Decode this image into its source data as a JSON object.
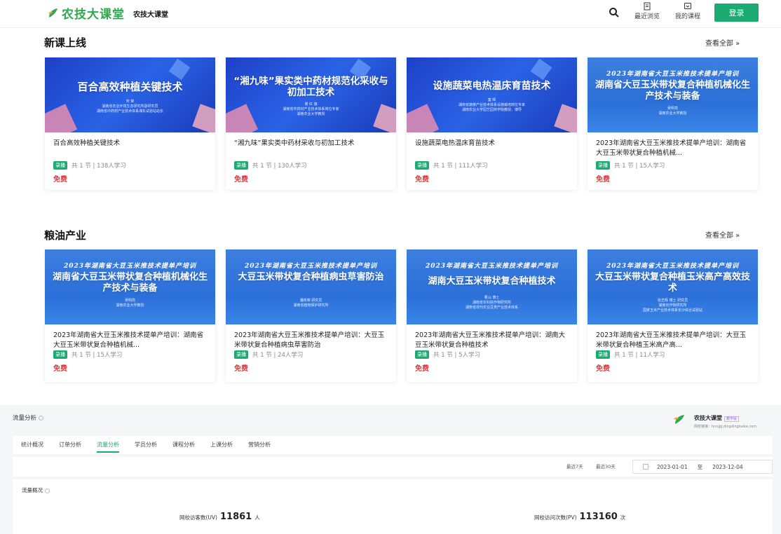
{
  "header": {
    "logo_text": "农技大课堂",
    "site_name": "农技大课堂",
    "nav": [
      {
        "label": "最近浏览",
        "icon": "history-icon"
      },
      {
        "label": "我的课程",
        "icon": "course-icon"
      }
    ],
    "login_label": "登录",
    "colors": {
      "brand": "#2fa84f",
      "accent": "#1aaa72",
      "price": "#e4393c"
    }
  },
  "sections": [
    {
      "title": "新课上线",
      "view_all": "查看全部 »",
      "courses": [
        {
          "cover_title": "百合高效种植关键技术",
          "cover_sub": [
            "宋 荣",
            "湖南省农业环境生态研究所副研究员",
            "湖南省中药材产业技术体系湘东试验站站长"
          ],
          "title": "百合高效种植关键技术",
          "tag": "录播",
          "meta": "共 1 节 | 138人学习",
          "price": "免费"
        },
        {
          "cover_title": "“湘九味”果实类中药材规范化采收与初加工技术",
          "cover_sub": [
            "谢 红 旗",
            "湖南省中药材产业技术体系岗位专家",
            "湖南农业大学教授"
          ],
          "title": "“湘九味”果实类中药材采收与初加工技术",
          "tag": "录播",
          "meta": "共 1 节 | 130人学习",
          "price": "免费"
        },
        {
          "cover_title": "设施蔬菜电热温床育苗技术",
          "cover_sub": [
            "童 辉",
            "湖南省蔬菜产业技术体系设施栽培岗位专家",
            "湖南农业大学园艺园林学院教授、博导"
          ],
          "title": "设施蔬菜电热温床育苗技术",
          "tag": "录播",
          "meta": "共 1 节 | 111人学习",
          "price": "免费"
        },
        {
          "cover_top": "2023年湖南省大豆玉米推技术提单产培训",
          "cover_title": "湖南省大豆玉米带状复合种植机械化生产技术与装备",
          "cover_sub": [
            "吴明亮",
            "湖南农业大学教授"
          ],
          "title": "2023年湖南省大豆玉米推技术提单产培训：湖南省大豆玉米带状复合种植机械...",
          "tag": "录播",
          "meta": "共 1 节 | 15人学习",
          "price": "免费"
        }
      ]
    },
    {
      "title": "粮油产业",
      "view_all": "查看全部 »",
      "courses": [
        {
          "cover_top": "2023年湖南省大豆玉米推技术提单产培训",
          "cover_title": "湖南省大豆玉米带状复合种植机械化生产技术与装备",
          "cover_sub": [
            "吴明亮",
            "湖南农业大学教授"
          ],
          "title": "2023年湖南省大豆玉米推技术提单产培训：湖南省大豆玉米带状复合种植机械...",
          "tag": "录播",
          "meta": "共 1 节 | 15人学习",
          "price": "免费"
        },
        {
          "cover_top": "2023年湖南省大豆玉米推技术提单产培训",
          "cover_title": "大豆玉米带状复合种植病虫草害防治",
          "cover_sub": [
            "潘彬荣 研究员",
            "湖南省植物保护研究所"
          ],
          "title": "2023年湖南省大豆玉米推技术提单产培训：大豆玉米带状复合种植病虫草害防治",
          "tag": "录播",
          "meta": "共 1 节 | 24人学习",
          "price": "免费"
        },
        {
          "cover_top": "2023年湖南省大豆玉米推技术提单产培训",
          "cover_title": "湖南大豆玉米带状复合种植技术",
          "cover_sub": [
            "曹山 博士",
            "湖南省农科院作物研究所",
            "湖南省现代农业豆类产业技术体系"
          ],
          "title": "2023年湖南省大豆玉米推技术提单产培训：湖南大豆玉米带状复合种植技术",
          "tag": "录播",
          "meta": "共 1 节 | 5人学习",
          "price": "免费"
        },
        {
          "cover_top": "2023年湖南省大豆玉米推技术提单产培训",
          "cover_title": "大豆玉米带状复合种植玉米高产高效技术",
          "cover_sub": [
            "张志辉 博士 研究员",
            "湖南省作物研究所",
            "国家玉米产业技术体系长沙综合试验站"
          ],
          "title": "2023年湖南省大豆玉米推技术提单产培训：大豆玉米带状复合种植玉米高产高...",
          "tag": "录播",
          "meta": "共 1 节 | 11人学习",
          "price": "免费"
        }
      ]
    }
  ],
  "analytics": {
    "title": "流量分析",
    "brand_name": "农技大课堂",
    "brand_badge": "教学版",
    "brand_url": "网校链接：hnnjjg.dingdingkaike.com",
    "tabs": [
      "统计概况",
      "订单分析",
      "流量分析",
      "学员分析",
      "课程分析",
      "上课分析",
      "营销分析"
    ],
    "active_tab": "流量分析",
    "range_buttons": [
      "最近7天",
      "最近30天"
    ],
    "date_from": "2023-01-01",
    "date_sep": "至",
    "date_to": "2023-12-04",
    "overview_title": "流量概况",
    "uv": {
      "label": "网校访客数(UV)",
      "value": "11861",
      "unit": "人"
    },
    "pv": {
      "label": "网校访问次数(PV)",
      "value": "113160",
      "unit": "次"
    }
  }
}
